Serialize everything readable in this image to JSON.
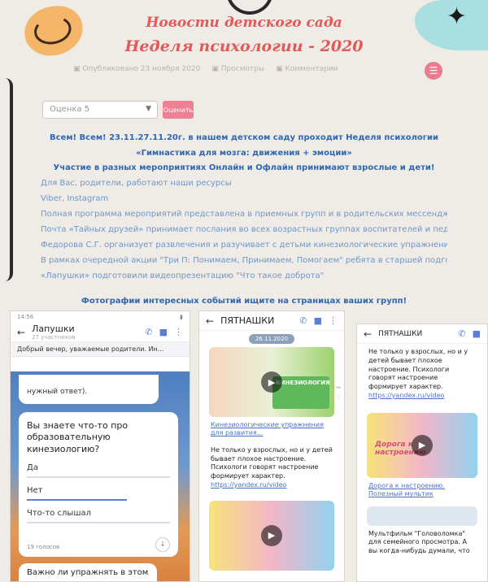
{
  "header": {
    "title_line1": "Новости детского сада",
    "title_line2": "Неделя психологии - 2020",
    "meta": [
      "Опубликовано 23 ноября 2020",
      "Просмотры",
      "Комментарии"
    ],
    "menu_icon": "☰"
  },
  "rating": {
    "selected": "Оценка 5",
    "button": "Оценить"
  },
  "article": {
    "line1": "Всем! Всем! 23.11.27.11.20г. в нашем детском саду проходит Неделя психологии",
    "line2": "«Гимнастика для мозга: движения + эмоции»",
    "line3": "Участие в разных мероприятиях Онлайн и Офлайн принимают взрослые и дети!",
    "line4": "Для Вас, родители, работают наши ресурсы",
    "line5": "Viber, Instagram",
    "line6": "Полная программа мероприятий представлена в приемных групп и в родительских мессенджерах!",
    "line7": "Почта «Тайных друзей» принимает послания во всех возрастных группах воспитателей и педагогов-психологов",
    "line8": "Федорова С.Г. организует развлечения и разучивает с детьми кинезиологические упражнения",
    "line9": "В рамках очередной акции \"Три П: Понимаем, Принимаем, Помогаем\" ребята в старшей подготовительной группы",
    "line10": "«Лапушки» подготовили видеопрезентацию \"Что такое доброта\"",
    "line11": "Фотографии интересных событий ищите на страницах ваших групп!"
  },
  "phone1": {
    "status": "14:58",
    "chat_name": "Лапушки",
    "chat_sub": "27 участников",
    "pinned": "Добрый вечер, уважаемые родители. Ин...",
    "prev_bubble": "нужный ответ).",
    "poll_question": "Вы знаете что-то про образовательную кинезиологию?",
    "options": [
      "Да",
      "Нет",
      "Что-то слышал"
    ],
    "votes": "19 голосов",
    "next_bubble": "Важно ли упражнять в этом"
  },
  "phone2": {
    "chat_name": "ПЯТНАШКИ",
    "date": "26.11.2020",
    "video_caption": "КИНЕЗИОЛОГИЯ",
    "link": "Кинезиологические упражнения для развития...",
    "message": "Не только у взрослых, но и у детей бывает плохое настроение. Психологи говорят настроение формирует характер.",
    "url": "https://yandex.ru/video"
  },
  "phone3": {
    "chat_name": "ПЯТНАШКИ",
    "message": "Не только у взрослых, но и у детей бывает плохое настроение. Психологи говорят настроение формирует характер.",
    "url": "https://yandex.ru/video",
    "video_caption": "Дорога к настроению",
    "link": "Дорога к настроению. Полезный мультик",
    "message2": "Мультфильм \"Головоломка\" для семейного просмотра. А вы когда-нибудь думали, что"
  }
}
